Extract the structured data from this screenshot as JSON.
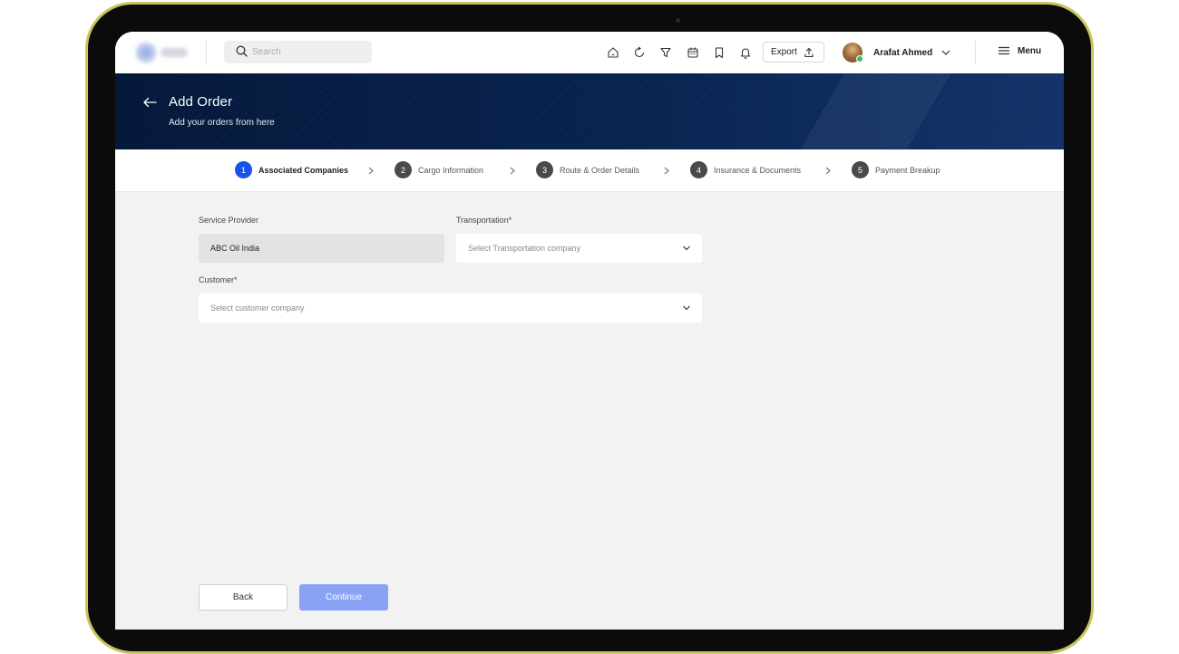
{
  "header": {
    "search_placeholder": "Search",
    "export_label": "Export",
    "user_name": "Arafat Ahmed",
    "menu_label": "Menu"
  },
  "banner": {
    "title": "Add Order",
    "subtitle": "Add your orders from here"
  },
  "steps": [
    {
      "num": "1",
      "label": "Associated Companies",
      "active": true
    },
    {
      "num": "2",
      "label": "Cargo Information",
      "active": false
    },
    {
      "num": "3",
      "label": "Route & Order Details",
      "active": false
    },
    {
      "num": "4",
      "label": "Insurance & Documents",
      "active": false
    },
    {
      "num": "5",
      "label": "Payment Breakup",
      "active": false
    }
  ],
  "form": {
    "service_provider_label": "Service Provider",
    "service_provider_value": "ABC Oil India",
    "transportation_label": "Transportation*",
    "transportation_placeholder": "Select Transportation company",
    "customer_label": "Customer*",
    "customer_placeholder": "Select customer company"
  },
  "actions": {
    "back_label": "Back",
    "continue_label": "Continue"
  },
  "colors": {
    "accent": "#1753e8",
    "continue_button": "#89a2f3",
    "banner": "#04183a",
    "device_frame": "#c8c35a"
  }
}
